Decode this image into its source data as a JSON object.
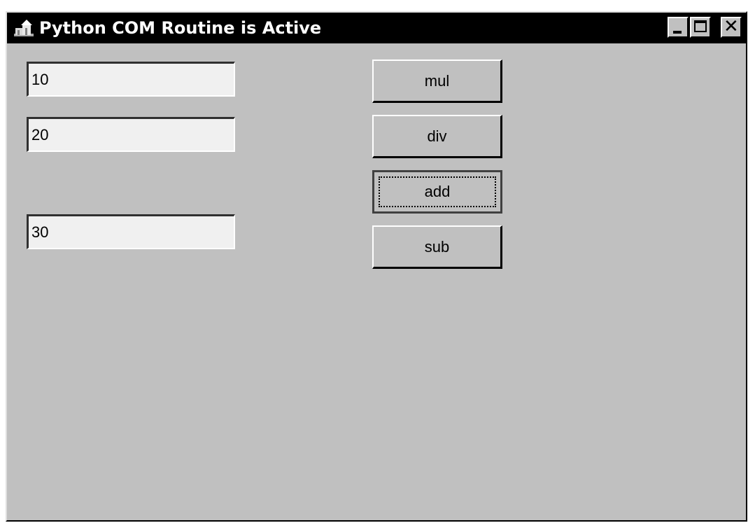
{
  "window": {
    "title": "Python COM Routine is Active",
    "icon": "python-app-icon"
  },
  "titlebar_buttons": {
    "minimize": "minimize-icon",
    "maximize": "maximize-icon",
    "close": "close-icon"
  },
  "fields": {
    "first_value": "10",
    "second_value": "20",
    "result_value": "30"
  },
  "buttons": {
    "mul": "mul",
    "div": "div",
    "add": "add",
    "sub": "sub",
    "focused": "add"
  },
  "colors": {
    "face": "#c0c0c0",
    "titlebar": "#000000",
    "field_bg": "#f0f0f0"
  }
}
